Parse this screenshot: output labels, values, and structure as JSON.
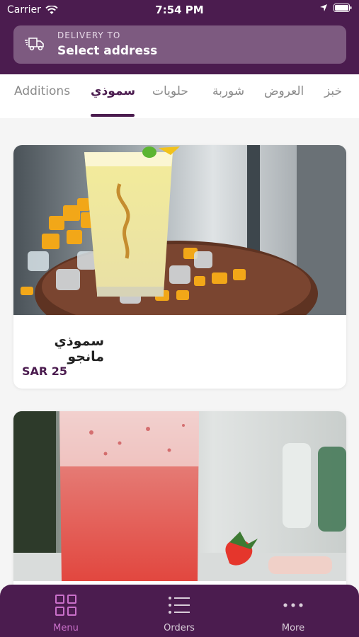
{
  "status_bar": {
    "carrier": "Carrier",
    "time": "7:54 PM"
  },
  "delivery": {
    "label": "DELIVERY TO",
    "value": "Select address"
  },
  "tabs": [
    {
      "label": "Additions"
    },
    {
      "label": "سموذي"
    },
    {
      "label": "حلويات"
    },
    {
      "label": "شوربة"
    },
    {
      "label": "العروض"
    },
    {
      "label": "خبز"
    }
  ],
  "active_tab": "سموذي",
  "products": [
    {
      "name": "سموذي مانجو",
      "price": "SAR 25"
    },
    {
      "name": "",
      "price": ""
    }
  ],
  "bottom_nav": [
    {
      "label": "Menu",
      "icon": "grid-icon"
    },
    {
      "label": "Orders",
      "icon": "list-icon"
    },
    {
      "label": "More",
      "icon": "more-icon"
    }
  ],
  "colors": {
    "brand": "#4b1c4f",
    "accent": "#c970c9",
    "address_bg": "#7d5a80"
  }
}
